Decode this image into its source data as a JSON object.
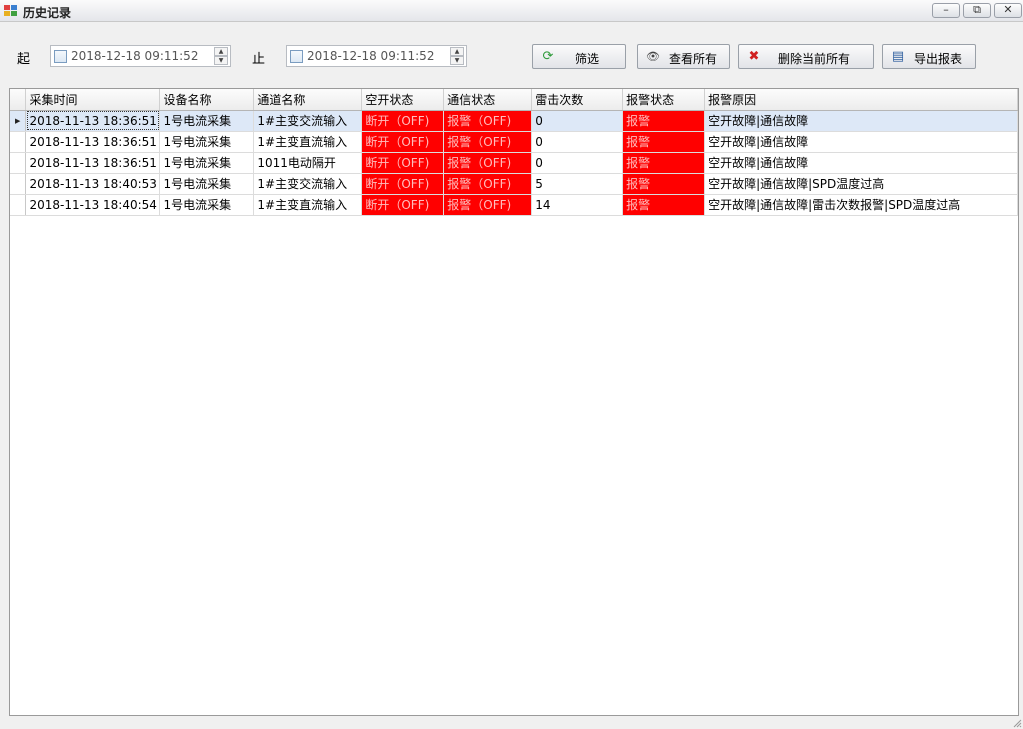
{
  "window": {
    "title": "历史记录",
    "minimize": "–",
    "restore": "⧉",
    "close": "✕"
  },
  "filter": {
    "start_label": "起",
    "end_label": "止",
    "start_value": "2018-12-18 09:11:52",
    "end_value": "2018-12-18 09:11:52",
    "spin_up": "▲",
    "spin_down": "▼"
  },
  "buttons": {
    "filter": {
      "label": "筛选",
      "icon": "refresh-icon",
      "glyph": "⟳"
    },
    "view_all": {
      "label": "查看所有",
      "icon": "eye-icon",
      "glyph": "👁"
    },
    "delete_all": {
      "label": "删除当前所有",
      "icon": "delete-table-icon",
      "glyph": "✖"
    },
    "export": {
      "label": "导出报表",
      "icon": "document-icon",
      "glyph": "▤"
    }
  },
  "grid": {
    "row_indicator": "▶",
    "columns": [
      "采集时间",
      "设备名称",
      "通道名称",
      "空开状态",
      "通信状态",
      "雷击次数",
      "报警状态",
      "报警原因"
    ],
    "rows": [
      [
        "2018-11-13 18:36:51",
        "1号电流采集",
        "1#主变交流输入",
        "断开（OFF)",
        "报警（OFF)",
        "0",
        "报警",
        "空开故障|通信故障"
      ],
      [
        "2018-11-13 18:36:51",
        "1号电流采集",
        "1#主变直流输入",
        "断开（OFF)",
        "报警（OFF)",
        "0",
        "报警",
        "空开故障|通信故障"
      ],
      [
        "2018-11-13 18:36:51",
        "1号电流采集",
        "1011电动隔开",
        "断开（OFF)",
        "报警（OFF)",
        "0",
        "报警",
        "空开故障|通信故障"
      ],
      [
        "2018-11-13 18:40:53",
        "1号电流采集",
        "1#主变交流输入",
        "断开（OFF)",
        "报警（OFF)",
        "5",
        "报警",
        "空开故障|通信故障|SPD温度过高"
      ],
      [
        "2018-11-13 18:40:54",
        "1号电流采集",
        "1#主变直流输入",
        "断开（OFF)",
        "报警（OFF)",
        "14",
        "报警",
        "空开故障|通信故障|雷击次数报警|SPD温度过高"
      ]
    ],
    "alarm_color": "#ff0000",
    "selected_row_color": "#dde8f7"
  }
}
